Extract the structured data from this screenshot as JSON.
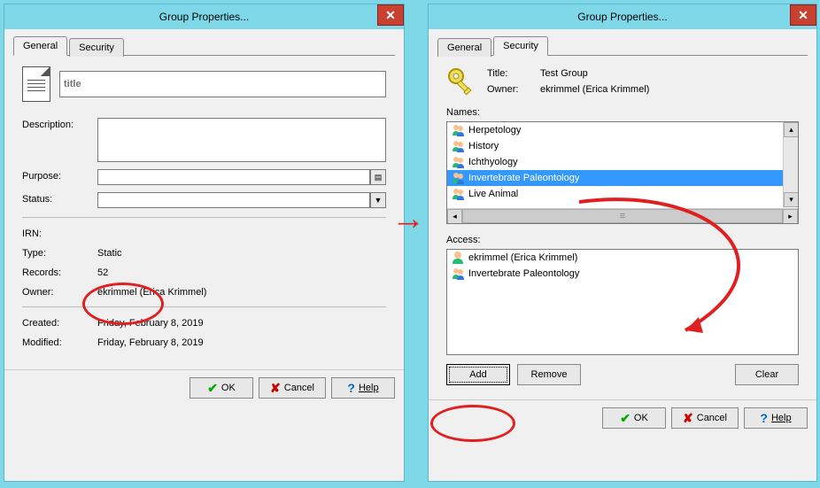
{
  "left": {
    "titlebar": "Group Properties...",
    "tabs": {
      "general": "General",
      "security": "Security"
    },
    "title_placeholder": "title",
    "labels": {
      "description": "Description:",
      "purpose": "Purpose:",
      "status": "Status:",
      "irn": "IRN:",
      "type": "Type:",
      "records": "Records:",
      "owner": "Owner:",
      "created": "Created:",
      "modified": "Modified:"
    },
    "values": {
      "type": "Static",
      "records": "52",
      "owner": "ekrimmel (Erica Krimmel)",
      "created": "Friday, February 8, 2019",
      "modified": "Friday, February 8, 2019"
    }
  },
  "right": {
    "titlebar": "Group Properties...",
    "tabs": {
      "general": "General",
      "security": "Security"
    },
    "labels": {
      "title": "Title:",
      "owner": "Owner:",
      "names": "Names:",
      "access": "Access:"
    },
    "values": {
      "title": "Test Group",
      "owner": "ekrimmel (Erica Krimmel)"
    },
    "names": [
      "Herpetology",
      "History",
      "Ichthyology",
      "Invertebrate Paleontology",
      "Live Animal"
    ],
    "access": [
      "ekrimmel (Erica Krimmel)",
      "Invertebrate Paleontology"
    ],
    "buttons": {
      "add": "Add",
      "remove": "Remove",
      "clear": "Clear"
    }
  },
  "footer": {
    "ok": "OK",
    "cancel": "Cancel",
    "help": "Help"
  }
}
